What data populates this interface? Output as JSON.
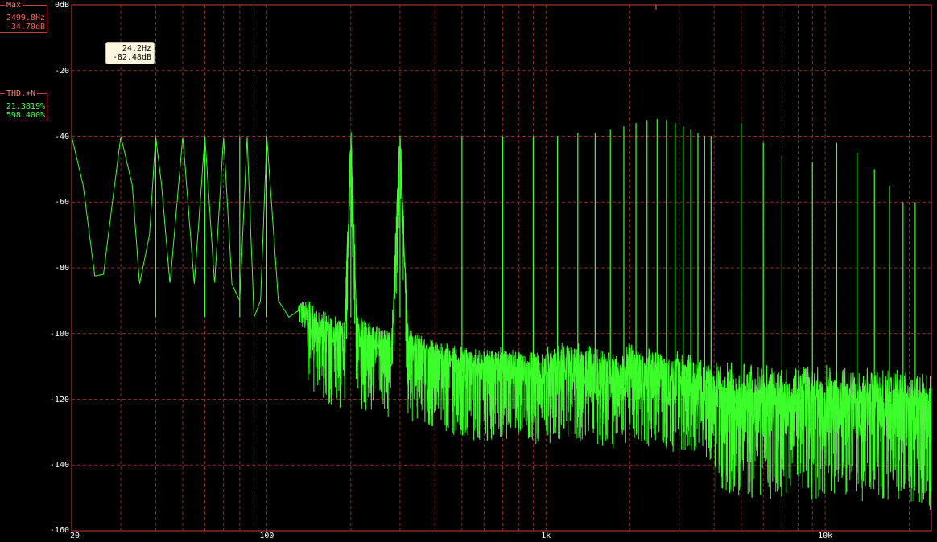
{
  "max_readout": {
    "title": "Max",
    "frequency": "2499.8Hz",
    "level": "-34.70dB"
  },
  "thd_readout": {
    "title": "THD.+N",
    "value1": "21.3819%",
    "value2": "598.400%"
  },
  "cursor": {
    "frequency": "24.2Hz",
    "level": "-82.48dB"
  },
  "colors": {
    "background": "#000000",
    "grid": "#8a2b2b",
    "trace": "#3cff2a",
    "labels": "#ffffff"
  },
  "chart_data": {
    "type": "line",
    "title": "",
    "xlabel": "",
    "ylabel": "",
    "x_scale": "log",
    "xlim": [
      20,
      24000
    ],
    "ylim": [
      -160,
      0
    ],
    "grid": true,
    "y_ticks": [
      "0dB",
      "-20",
      "-40",
      "-60",
      "-80",
      "-100",
      "-120",
      "-140",
      "-160"
    ],
    "x_ticks": [
      "20",
      "100",
      "1k",
      "10k"
    ],
    "series": [
      {
        "x": [
          20,
          22,
          24.2,
          26,
          28,
          30,
          33,
          35,
          38,
          40,
          42,
          45,
          50,
          55,
          60,
          65,
          70,
          75,
          80,
          85,
          90,
          95,
          100,
          110,
          120,
          130,
          150,
          170,
          190,
          200,
          210,
          230,
          250,
          280,
          300,
          320,
          350,
          400,
          500,
          600,
          700,
          800,
          1000,
          1200,
          1500,
          1800,
          2000,
          2200,
          2500,
          2800,
          3000,
          3200,
          3500,
          3800,
          4000,
          4200,
          4500,
          5000,
          6000,
          7000,
          8000,
          9000,
          10000,
          12000,
          14000,
          16000,
          18000,
          20000,
          22000,
          24000
        ],
        "y": [
          -40,
          -55,
          -82.5,
          -82,
          -60,
          -40,
          -55,
          -85,
          -70,
          -40,
          -55,
          -85,
          -40,
          -85,
          -40,
          -85,
          -40,
          -85,
          -90,
          -40,
          -95,
          -90,
          -40,
          -90,
          -95,
          -93,
          -98,
          -100,
          -102,
          -40,
          -100,
          -102,
          -104,
          -105,
          -40,
          -104,
          -106,
          -108,
          -110,
          -111,
          -110,
          -111,
          -112,
          -110,
          -112,
          -114,
          -110,
          -113,
          -112,
          -114,
          -113,
          -114,
          -115,
          -116,
          -118,
          -120,
          -119,
          -120,
          -120,
          -121,
          -121,
          -121,
          -120,
          -121,
          -121,
          -121,
          -122,
          -122,
          -122,
          -124
        ]
      }
    ],
    "harmonic_peaks": [
      {
        "x": 40,
        "y": -40
      },
      {
        "x": 60,
        "y": -40
      },
      {
        "x": 80,
        "y": -40
      },
      {
        "x": 100,
        "y": -40
      },
      {
        "x": 200,
        "y": -40
      },
      {
        "x": 300,
        "y": -40
      },
      {
        "x": 500,
        "y": -40
      },
      {
        "x": 700,
        "y": -40
      },
      {
        "x": 900,
        "y": -40
      },
      {
        "x": 1100,
        "y": -40
      },
      {
        "x": 1300,
        "y": -39
      },
      {
        "x": 1500,
        "y": -39
      },
      {
        "x": 1700,
        "y": -38
      },
      {
        "x": 1900,
        "y": -37
      },
      {
        "x": 2100,
        "y": -36
      },
      {
        "x": 2300,
        "y": -35
      },
      {
        "x": 2500,
        "y": -34.7
      },
      {
        "x": 2700,
        "y": -35
      },
      {
        "x": 2900,
        "y": -36
      },
      {
        "x": 3100,
        "y": -37
      },
      {
        "x": 3300,
        "y": -38
      },
      {
        "x": 3500,
        "y": -39
      },
      {
        "x": 3700,
        "y": -40
      },
      {
        "x": 3900,
        "y": -40
      },
      {
        "x": 5000,
        "y": -36
      },
      {
        "x": 6000,
        "y": -42
      },
      {
        "x": 7000,
        "y": -46
      },
      {
        "x": 9000,
        "y": -48
      },
      {
        "x": 11000,
        "y": -42
      },
      {
        "x": 13000,
        "y": -45
      },
      {
        "x": 15000,
        "y": -50
      },
      {
        "x": 17000,
        "y": -55
      },
      {
        "x": 19000,
        "y": -60
      },
      {
        "x": 21000,
        "y": -60
      }
    ]
  }
}
